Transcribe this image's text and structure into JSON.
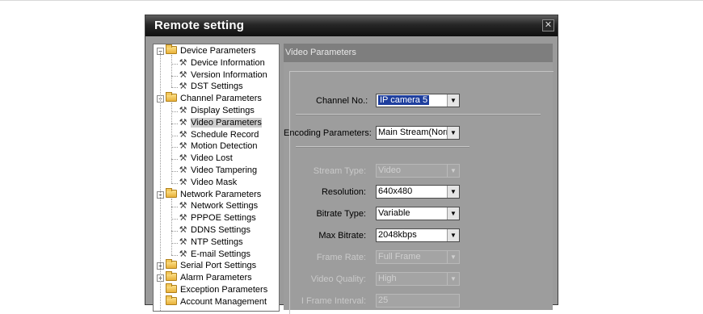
{
  "dialog": {
    "title": "Remote setting",
    "close_glyph": "✕"
  },
  "tree": [
    {
      "label": "Device Parameters",
      "type": "folder",
      "expander": "−"
    },
    {
      "label": "Device Information",
      "type": "leaf"
    },
    {
      "label": "Version Information",
      "type": "leaf"
    },
    {
      "label": "DST Settings",
      "type": "leaf"
    },
    {
      "label": "Channel Parameters",
      "type": "folder",
      "expander": "−"
    },
    {
      "label": "Display Settings",
      "type": "leaf"
    },
    {
      "label": "Video Parameters",
      "type": "leaf",
      "selected": true
    },
    {
      "label": "Schedule Record",
      "type": "leaf"
    },
    {
      "label": "Motion Detection",
      "type": "leaf"
    },
    {
      "label": "Video Lost",
      "type": "leaf"
    },
    {
      "label": "Video Tampering",
      "type": "leaf"
    },
    {
      "label": "Video Mask",
      "type": "leaf"
    },
    {
      "label": "Network Parameters",
      "type": "folder",
      "expander": "−"
    },
    {
      "label": "Network Settings",
      "type": "leaf"
    },
    {
      "label": "PPPOE Settings",
      "type": "leaf"
    },
    {
      "label": "DDNS Settings",
      "type": "leaf"
    },
    {
      "label": "NTP Settings",
      "type": "leaf"
    },
    {
      "label": "E-mail Settings",
      "type": "leaf"
    },
    {
      "label": "Serial Port Settings",
      "type": "folder",
      "expander": "+"
    },
    {
      "label": "Alarm Parameters",
      "type": "folder",
      "expander": "+"
    },
    {
      "label": "Exception Parameters",
      "type": "folder"
    },
    {
      "label": "Account Management",
      "type": "folder"
    }
  ],
  "panel": {
    "header": "Video Parameters",
    "channel": {
      "label": "Channel No.:",
      "value": "IP camera 5"
    },
    "encoding": {
      "label": "Encoding Parameters:",
      "value": "Main Stream(Norm"
    },
    "stream_type": {
      "label": "Stream Type:",
      "value": "Video"
    },
    "resolution": {
      "label": "Resolution:",
      "value": "640x480"
    },
    "bitrate_type": {
      "label": "Bitrate Type:",
      "value": "Variable"
    },
    "max_bitrate": {
      "label": "Max Bitrate:",
      "value": "2048kbps"
    },
    "frame_rate": {
      "label": "Frame Rate:",
      "value": "Full Frame"
    },
    "video_quality": {
      "label": "Video Quality:",
      "value": "High"
    },
    "i_frame_interval": {
      "label": "I Frame Interval:",
      "value": "25"
    }
  },
  "colors": {
    "selection": "#1f3f9e",
    "title_bar": "#1a1a1a",
    "panel_bg": "#9d9d9d"
  },
  "icons": {
    "folder": "folder-icon",
    "leaf": "wrench-icon",
    "arrow": "▼"
  }
}
